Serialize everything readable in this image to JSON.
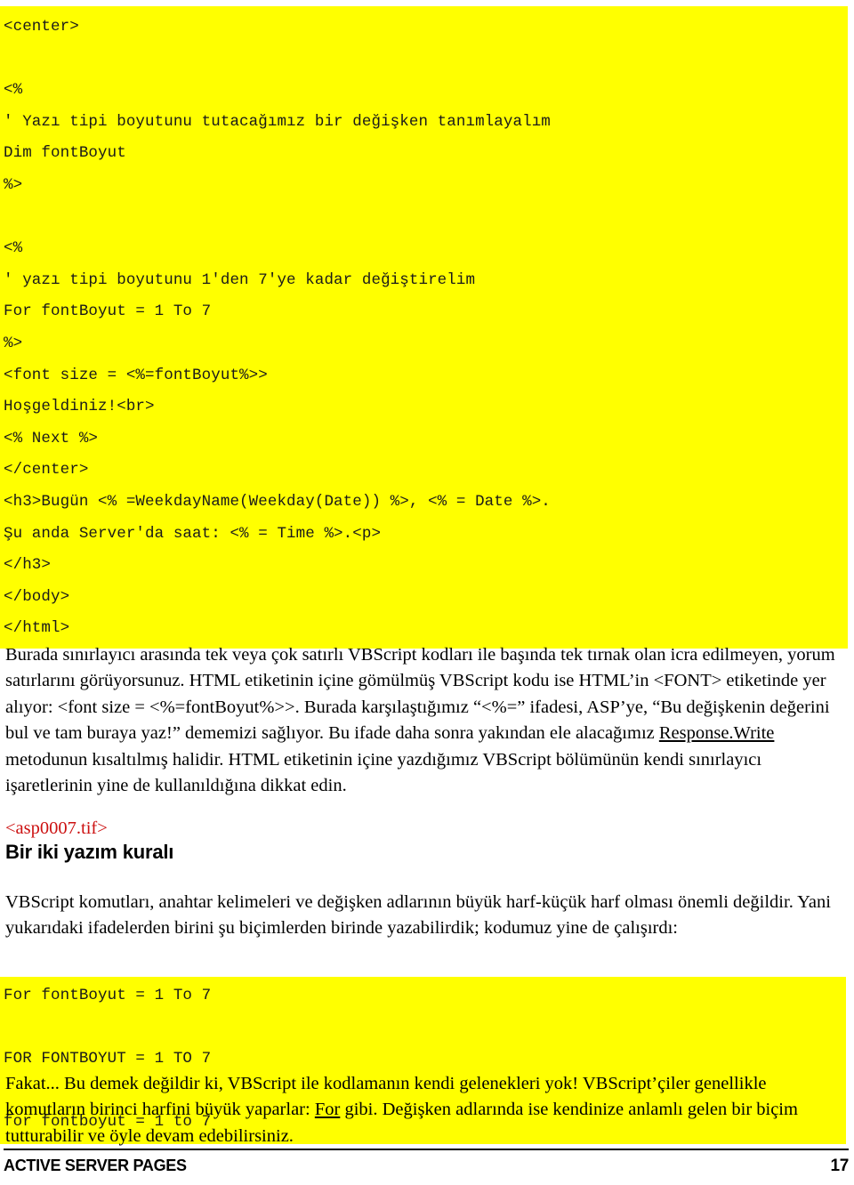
{
  "document": {
    "title": "ACTIVE SERVER PAGES",
    "page_number": "17",
    "colors": {
      "code_highlight": "#ffff00",
      "text": "#000000",
      "marker": "#cc1111"
    }
  },
  "code_block_top": {
    "lines": [
      "<center>",
      "",
      "<%",
      "' Yazı tipi boyutunu tutacağımız bir değişken tanımlayalım",
      "Dim fontBoyut",
      "%>",
      "",
      "<%",
      "' yazı tipi boyutunu 1'den 7'ye kadar değiştirelim",
      "For fontBoyut = 1 To 7",
      "%>",
      "<font size = <%=fontBoyut%>>",
      "Hoşgeldiniz!<br>",
      "<% Next %>",
      "</center>",
      "<h3>Bugün <% =WeekdayName(Weekday(Date)) %>, <% = Date %>.",
      "Şu anda Server'da saat: <% = Time %>.<p>",
      "</h3>",
      "</body>",
      "</html>"
    ]
  },
  "paragraph_main": {
    "segments": [
      {
        "type": "text",
        "value": "Burada sınırlayıcı arasında tek veya çok satırlı VBScript kodları ile başında tek tırnak olan icra edilmeyen, yorum satırlarını görüyorsunuz. HTML etiketinin içine gömülmüş VBScript kodu ise HTML’in <FONT> etiketinde yer alıyor: <font size = <%=fontBoyut%>>. Burada karşılaştığımız “<%=” ifadesi, ASP’ye, “Bu değişkenin değerini bul ve tam buraya yaz!” dememizi sağlıyor. Bu ifade daha sonra yakından ele alacağımız "
      },
      {
        "type": "underline",
        "value": "Response.Write"
      },
      {
        "type": "text",
        "value": " metodunun kısaltılmış halidir. HTML etiketinin içine yazdığımız VBScript bölümünün kendi sınırlayıcı işaretlerinin yine de kullanıldığına dikkat edin."
      }
    ]
  },
  "tif_marker": {
    "label": "<asp0007.tif>"
  },
  "section_heading": {
    "label": "Bir iki yazım kuralı"
  },
  "paragraph_rules": {
    "text": "VBScript komutları, anahtar kelimeleri ve değişken adlarının büyük harf-küçük harf olması önemli değildir. Yani yukarıdaki ifadelerden birini şu biçimlerden birinde yazabilirdik; kodumuz yine de çalışırdı:"
  },
  "code_block_bottom": {
    "lines": [
      "For fontBoyut = 1 To 7",
      "",
      "FOR FONTBOYUT = 1 TO 7",
      "",
      "for fontboyut = 1 to 7"
    ]
  },
  "paragraph_final": {
    "segments": [
      {
        "type": "text",
        "value": "Fakat... Bu demek değildir ki, VBScript ile kodlamanın kendi gelenekleri yok! VBScript’çiler genellikle komutların birinci harfini büyük yaparlar: "
      },
      {
        "type": "underline",
        "value": "For"
      },
      {
        "type": "text",
        "value": " gibi. Değişken adlarında ise kendinize anlamlı gelen bir biçim tutturabilir ve öyle devam edebilirsiniz."
      }
    ]
  }
}
